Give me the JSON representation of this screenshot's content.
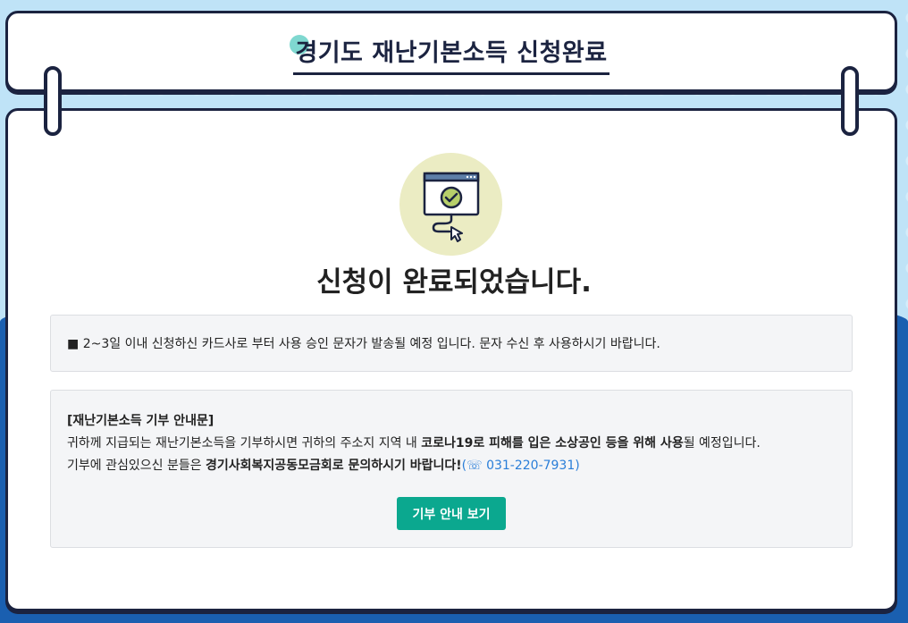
{
  "header": {
    "title": "경기도 재난기본소득 신청완료"
  },
  "main": {
    "icon": "browser-check-cursor-icon",
    "heading": "신청이 완료되었습니다.",
    "notice": {
      "bullet": "■",
      "text": "2~3일 이내 신청하신 카드사로 부터 사용 승인 문자가 발송될 예정 입니다. 문자 수신 후 사용하시기 바랍니다."
    },
    "donation": {
      "title": "[재난기본소득 기부 안내문]",
      "line1_a": "귀하께 지급되는 재난기본소득을 기부하시면 귀하의 주소지 지역 내 ",
      "line1_bold": "코로나19로 피해를 입은 소상공인 등을 위해 사용",
      "line1_b": "될 예정입니다.",
      "line2_a": "기부에 관심있으신 분들은 ",
      "line2_bold": "경기사회복지공동모금회로 문의하시기 바랍니다!",
      "phone": "(☏ 031-220-7931)",
      "button_label": "기부 안내 보기"
    }
  },
  "colors": {
    "navy": "#1b2340",
    "accent_teal": "#0ba88f",
    "phone_blue": "#2a7ed8",
    "icon_bg": "#ebecc3"
  }
}
